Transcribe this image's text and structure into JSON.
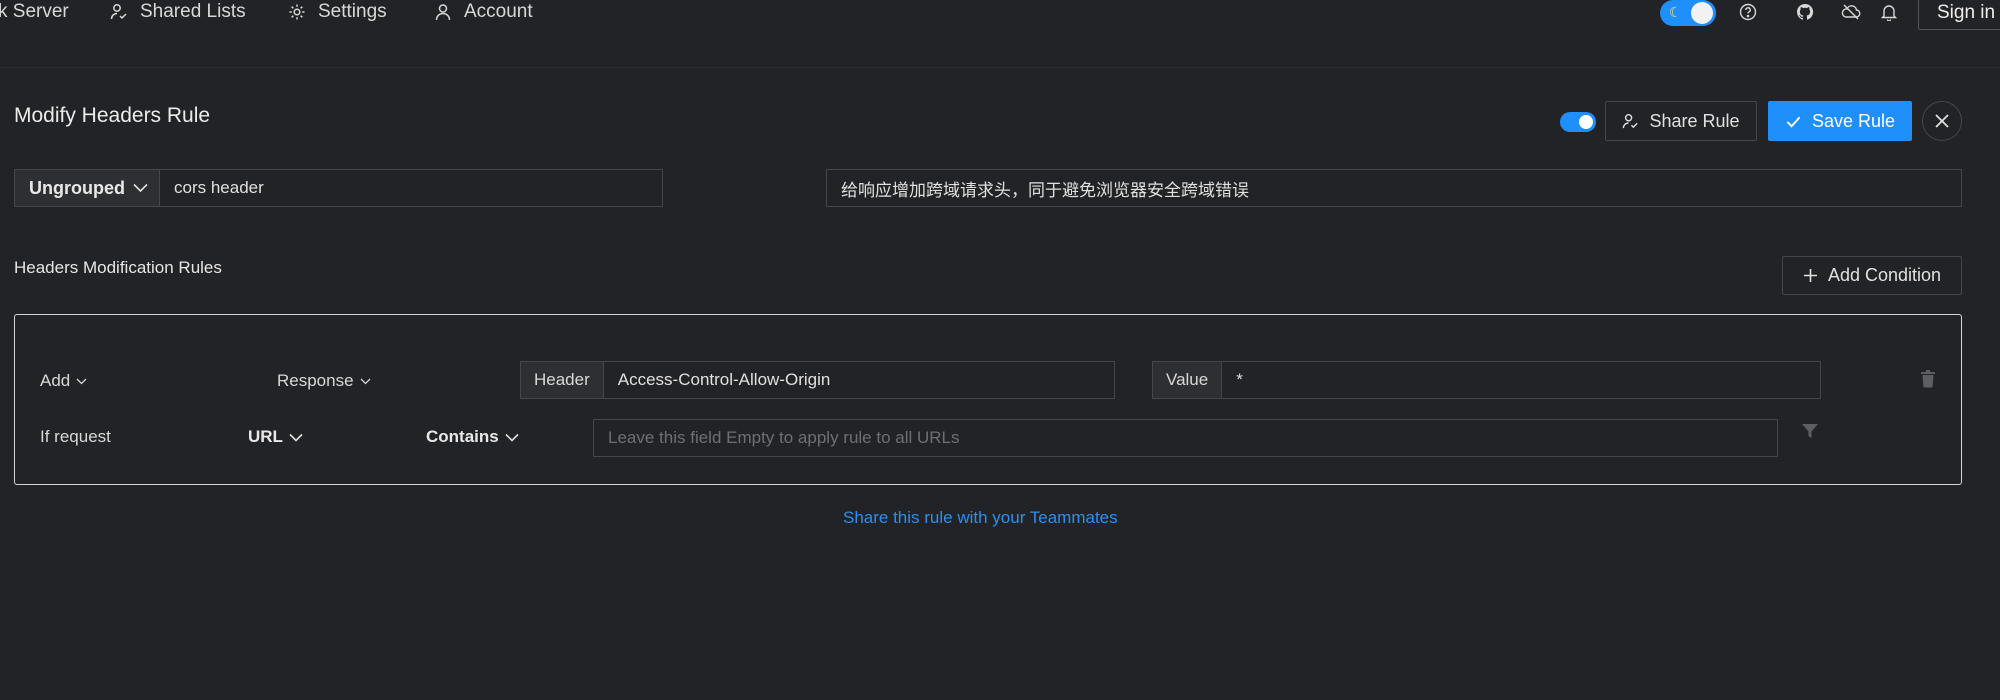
{
  "nav": {
    "items": [
      {
        "label": "k Server",
        "icon": "server-icon"
      },
      {
        "label": "Shared Lists",
        "icon": "shared-lists-icon"
      },
      {
        "label": "Settings",
        "icon": "gear-icon"
      },
      {
        "label": "Account",
        "icon": "user-icon"
      }
    ],
    "sign_in": "Sign in"
  },
  "rule": {
    "title": "Modify Headers Rule",
    "enabled": true,
    "share_label": "Share Rule",
    "save_label": "Save Rule",
    "group": "Ungrouped",
    "name": "cors header",
    "description": "给响应增加跨域请求头，同于避免浏览器安全跨域错误"
  },
  "modifications": {
    "section_title": "Headers Modification Rules",
    "add_condition_label": "Add Condition",
    "action": "Add",
    "target": "Response",
    "header_addon": "Header",
    "header_value": "Access-Control-Allow-Origin",
    "value_addon": "Value",
    "value_value": "*"
  },
  "condition": {
    "label": "If request",
    "field": "URL",
    "operator": "Contains",
    "placeholder": "Leave this field Empty to apply rule to all URLs"
  },
  "share_link": "Share this rule with your Teammates",
  "colors": {
    "background": "#222327",
    "primary": "#1e8ffb",
    "link": "#2a8ff0",
    "border": "#45464b"
  }
}
